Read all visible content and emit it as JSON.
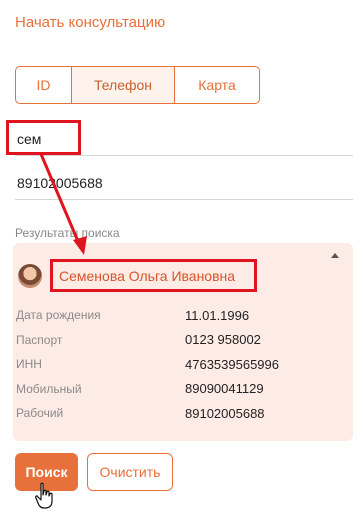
{
  "header": {
    "title": "Начать консультацию"
  },
  "tabs": [
    {
      "label": "ID"
    },
    {
      "label": "Телефон"
    },
    {
      "label": "Карта"
    }
  ],
  "form": {
    "name_value": "сем",
    "phone_value": "89102005688"
  },
  "results": {
    "label": "Результаты поиска",
    "person": {
      "name": "Семенова Ольга Ивановна",
      "fields": [
        {
          "label": "Дата рождения",
          "value": "11.01.1996"
        },
        {
          "label": "Паспорт",
          "value": "0123 958002"
        },
        {
          "label": "ИНН",
          "value": "4763539565996"
        },
        {
          "label": "Мобильный",
          "value": "89090041129"
        },
        {
          "label": "Рабочий",
          "value": "89102005688"
        }
      ]
    }
  },
  "buttons": {
    "search_label": "Поиск",
    "clear_label": "Очистить"
  },
  "colors": {
    "accent": "#e8703a",
    "highlight": "#e0141e",
    "card_bg": "#fdece6"
  }
}
